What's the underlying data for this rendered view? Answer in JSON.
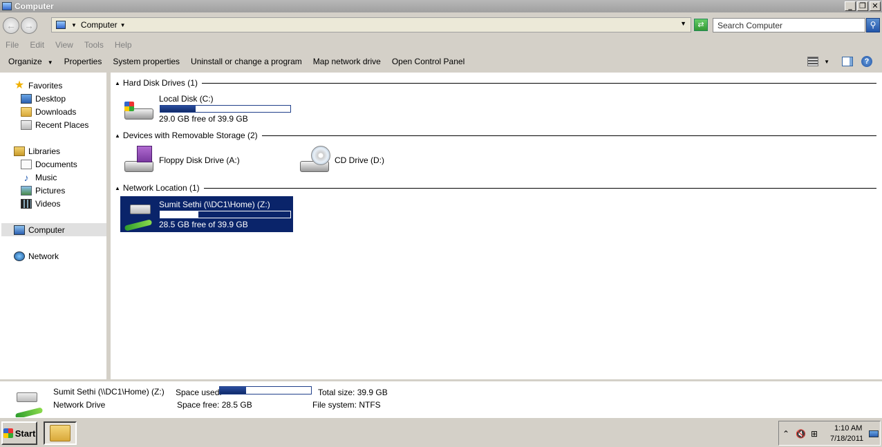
{
  "window": {
    "title": "Computer"
  },
  "address": {
    "crumb": "Computer",
    "search_placeholder": "Search Computer"
  },
  "menu": [
    "File",
    "Edit",
    "View",
    "Tools",
    "Help"
  ],
  "commands": {
    "organize": "Organize",
    "properties": "Properties",
    "system_properties": "System properties",
    "uninstall": "Uninstall or change a program",
    "map_drive": "Map network drive",
    "control_panel": "Open Control Panel"
  },
  "nav": {
    "favorites": "Favorites",
    "desktop": "Desktop",
    "downloads": "Downloads",
    "recent": "Recent Places",
    "libraries": "Libraries",
    "documents": "Documents",
    "music": "Music",
    "pictures": "Pictures",
    "videos": "Videos",
    "computer": "Computer",
    "network": "Network"
  },
  "groups": {
    "hdd": "Hard Disk Drives (1)",
    "removable": "Devices with Removable Storage (2)",
    "network": "Network Location (1)"
  },
  "drives": {
    "c": {
      "name": "Local Disk (C:)",
      "free": "29.0 GB free of 39.9 GB",
      "used_fraction": 0.27
    },
    "a": {
      "name": "Floppy Disk Drive (A:)"
    },
    "d": {
      "name": "CD Drive (D:)"
    },
    "z": {
      "name": "Sumit Sethi (\\\\DC1\\Home) (Z:)",
      "free": "28.5 GB free of 39.9 GB",
      "used_fraction": 0.29
    }
  },
  "details": {
    "title": "Sumit Sethi (\\\\DC1\\Home) (Z:)",
    "type": "Network Drive",
    "space_used_label": "Space used:",
    "space_used_fraction": 0.29,
    "space_free": "Space free: 28.5 GB",
    "total_size": "Total size: 39.9 GB",
    "file_system": "File system: NTFS"
  },
  "taskbar": {
    "start": "Start",
    "time": "1:10 AM",
    "date": "7/18/2011"
  }
}
